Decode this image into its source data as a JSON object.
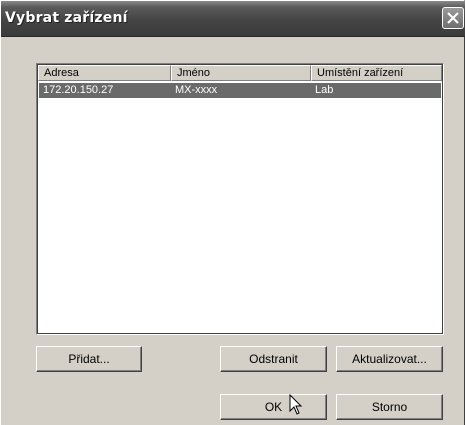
{
  "window": {
    "title": "Vybrat zařízení"
  },
  "titlebar": {
    "close_icon": "close-icon"
  },
  "list": {
    "columns": [
      "Adresa",
      "Jméno",
      "Umístění zařízení"
    ],
    "rows": [
      {
        "address": "172.20.150.27",
        "name": "MX-xxxx",
        "location": "Lab",
        "selected": true
      }
    ]
  },
  "buttons": {
    "add": "Přidat...",
    "remove": "Odstranit",
    "update": "Aktualizovat...",
    "ok": "OK",
    "cancel": "Storno"
  },
  "cursor": {
    "icon": "arrow-cursor-icon"
  },
  "colors": {
    "titlebar": "#444444",
    "selection": "#6a6a6a",
    "face": "#d4d0c8"
  }
}
